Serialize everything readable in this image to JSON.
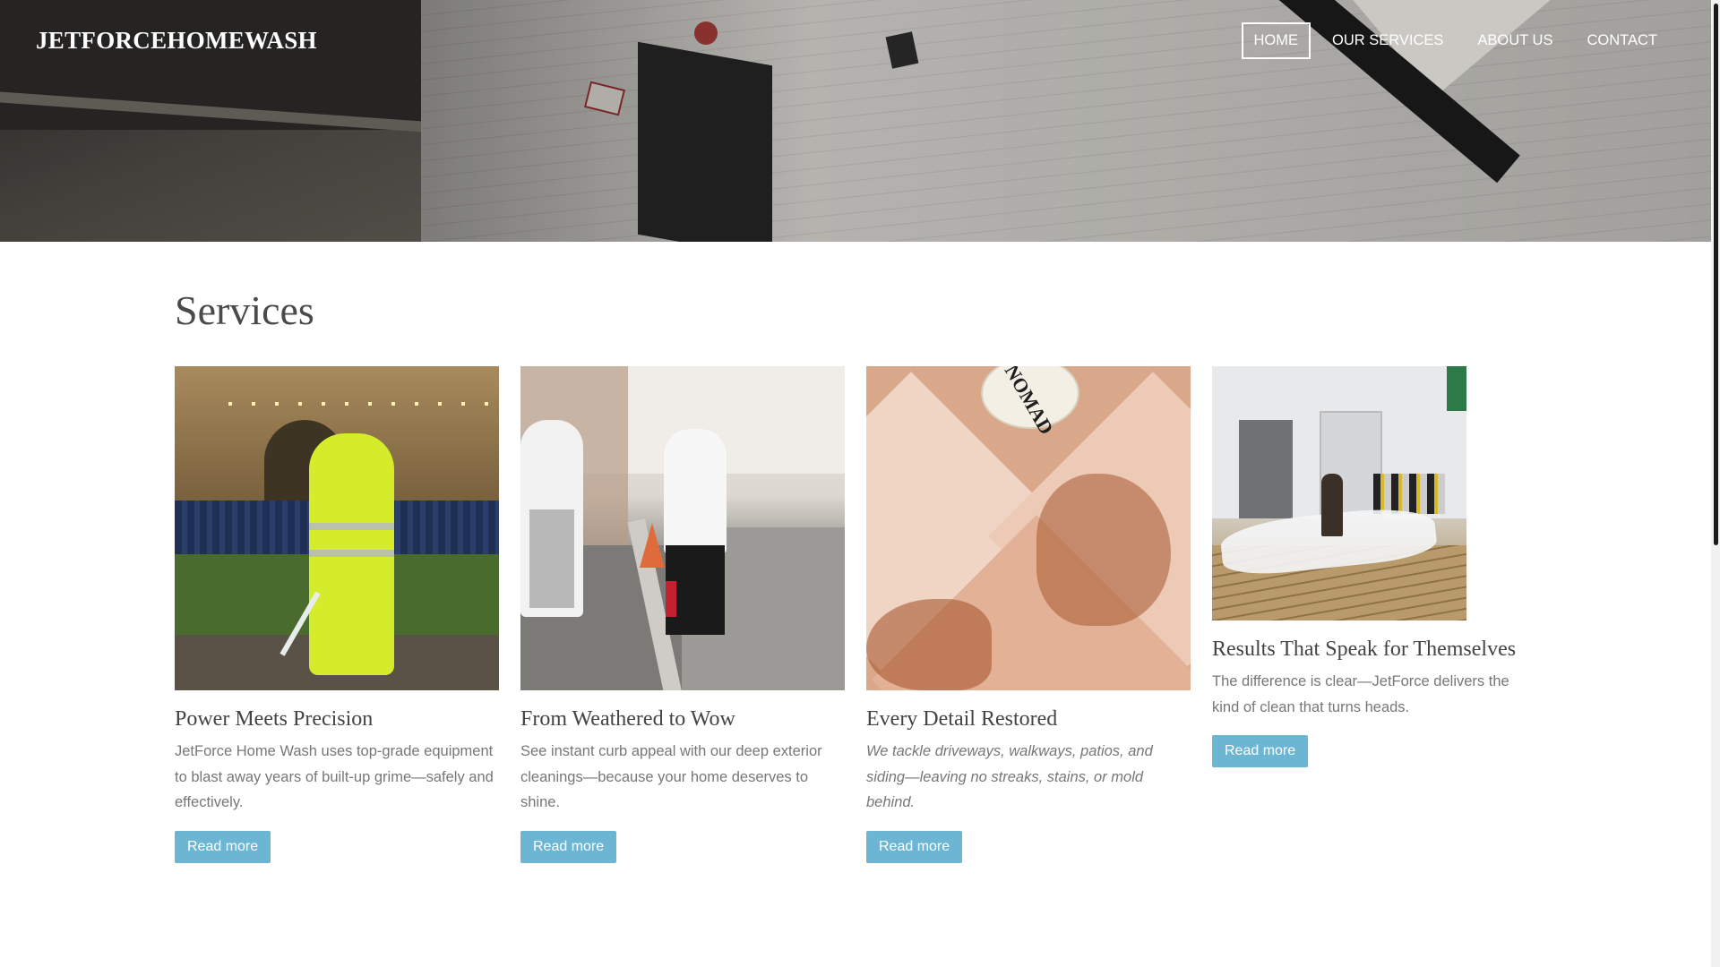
{
  "header": {
    "brand": "JETFORCEHOMEWASH",
    "nav": [
      {
        "label": "HOME",
        "active": true
      },
      {
        "label": "OUR SERVICES",
        "active": false
      },
      {
        "label": "ABOUT US",
        "active": false
      },
      {
        "label": "CONTACT",
        "active": false
      }
    ]
  },
  "services": {
    "title": "Services",
    "cards": [
      {
        "title": "Power Meets Precision",
        "text": "JetForce Home Wash uses top-grade equipment to blast away years of built-up grime—safely and effectively.",
        "button": "Read more"
      },
      {
        "title": "From Weathered to Wow",
        "text": "See instant curb appeal with our deep exterior cleanings—because your home deserves to shine.",
        "button": "Read more"
      },
      {
        "title": "Every Detail Restored",
        "text": "We tackle driveways, walkways, patios, and siding—leaving no streaks, stains, or mold behind.",
        "button": "Read more"
      },
      {
        "title": "Results That Speak for Themselves",
        "text": "The difference is clear—JetForce delivers the kind of clean that turns heads.",
        "button": "Read more"
      }
    ],
    "image_hat_text": "NOMAD"
  },
  "colors": {
    "button_bg": "#6cb6d4",
    "title_text": "#4a4a4a",
    "body_text": "#777777"
  }
}
